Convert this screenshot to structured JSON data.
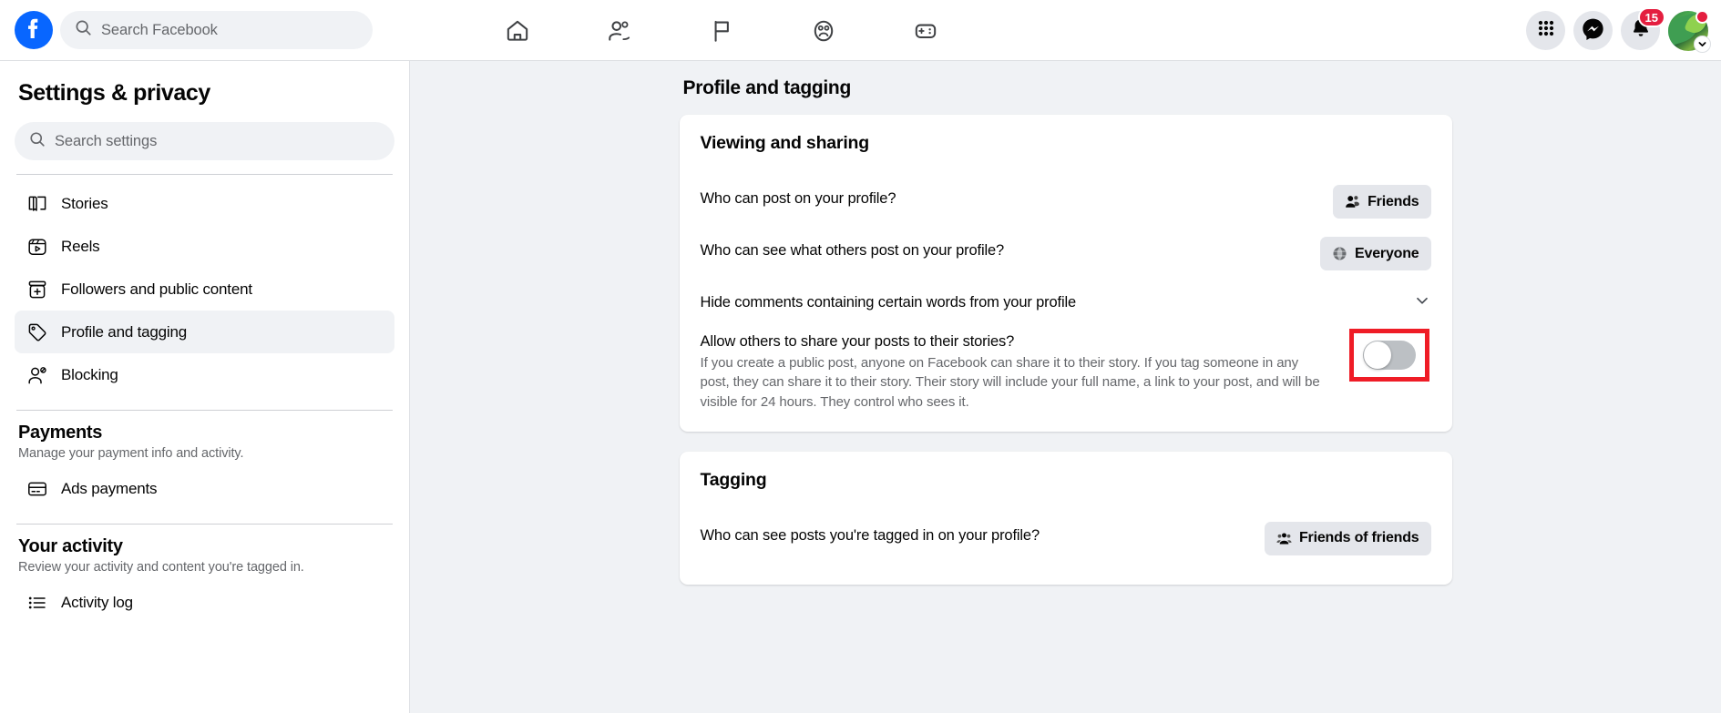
{
  "header": {
    "logo_icon": "facebook-logo-icon",
    "search": {
      "icon": "search-icon",
      "placeholder": "Search Facebook",
      "value": ""
    },
    "nav": [
      {
        "name": "home",
        "icon": "home-icon"
      },
      {
        "name": "friends",
        "icon": "friends-icon"
      },
      {
        "name": "video",
        "icon": "flag-icon"
      },
      {
        "name": "groups",
        "icon": "groups-icon"
      },
      {
        "name": "gaming",
        "icon": "gaming-controller-icon"
      }
    ],
    "actions": {
      "menu_icon": "grid-menu-icon",
      "messenger_icon": "messenger-icon",
      "notifications_icon": "bell-icon",
      "notifications_count": "15",
      "avatar_icon": "avatar",
      "avatar_chevron_icon": "chevron-down-icon"
    },
    "colors": {
      "brand_blue": "#0866ff",
      "badge_red": "#e41e3f"
    }
  },
  "sidebar": {
    "title": "Settings & privacy",
    "search": {
      "icon": "search-icon",
      "placeholder": "Search settings",
      "value": ""
    },
    "items": [
      {
        "label": "Stories",
        "icon": "book-icon",
        "active": false
      },
      {
        "label": "Reels",
        "icon": "reels-icon",
        "active": false
      },
      {
        "label": "Followers and public content",
        "icon": "plus-box-icon",
        "active": false
      },
      {
        "label": "Profile and tagging",
        "icon": "tag-icon",
        "active": true
      },
      {
        "label": "Blocking",
        "icon": "person-block-icon",
        "active": false
      }
    ],
    "groups": [
      {
        "title": "Payments",
        "subtitle": "Manage your payment info and activity.",
        "items": [
          {
            "label": "Ads payments",
            "icon": "credit-card-icon"
          }
        ]
      },
      {
        "title": "Your activity",
        "subtitle": "Review your activity and content you're tagged in.",
        "items": [
          {
            "label": "Activity log",
            "icon": "list-icon"
          }
        ]
      }
    ]
  },
  "main": {
    "page_title": "Profile and tagging",
    "cards": [
      {
        "title": "Viewing and sharing",
        "rows": [
          {
            "type": "select",
            "label": "Who can post on your profile?",
            "value": "Friends",
            "value_icon": "friends-icon"
          },
          {
            "type": "select",
            "label": "Who can see what others post on your profile?",
            "value": "Everyone",
            "value_icon": "globe-icon"
          },
          {
            "type": "collapse",
            "label": "Hide comments containing certain words from your profile",
            "chevron_icon": "chevron-down-icon"
          },
          {
            "type": "toggle",
            "label": "Allow others to share your posts to their stories?",
            "description": "If you create a public post, anyone on Facebook can share it to their story. If you tag someone in any post, they can share it to their story. Their story will include your full name, a link to your post, and will be visible for 24 hours. They control who sees it.",
            "toggle_state": "off",
            "highlighted": true,
            "highlight_color": "#ef1c26"
          }
        ]
      },
      {
        "title": "Tagging",
        "rows": [
          {
            "type": "select",
            "label": "Who can see posts you're tagged in on your profile?",
            "value": "Friends of friends",
            "value_icon": "friends-group-icon"
          }
        ]
      }
    ]
  }
}
